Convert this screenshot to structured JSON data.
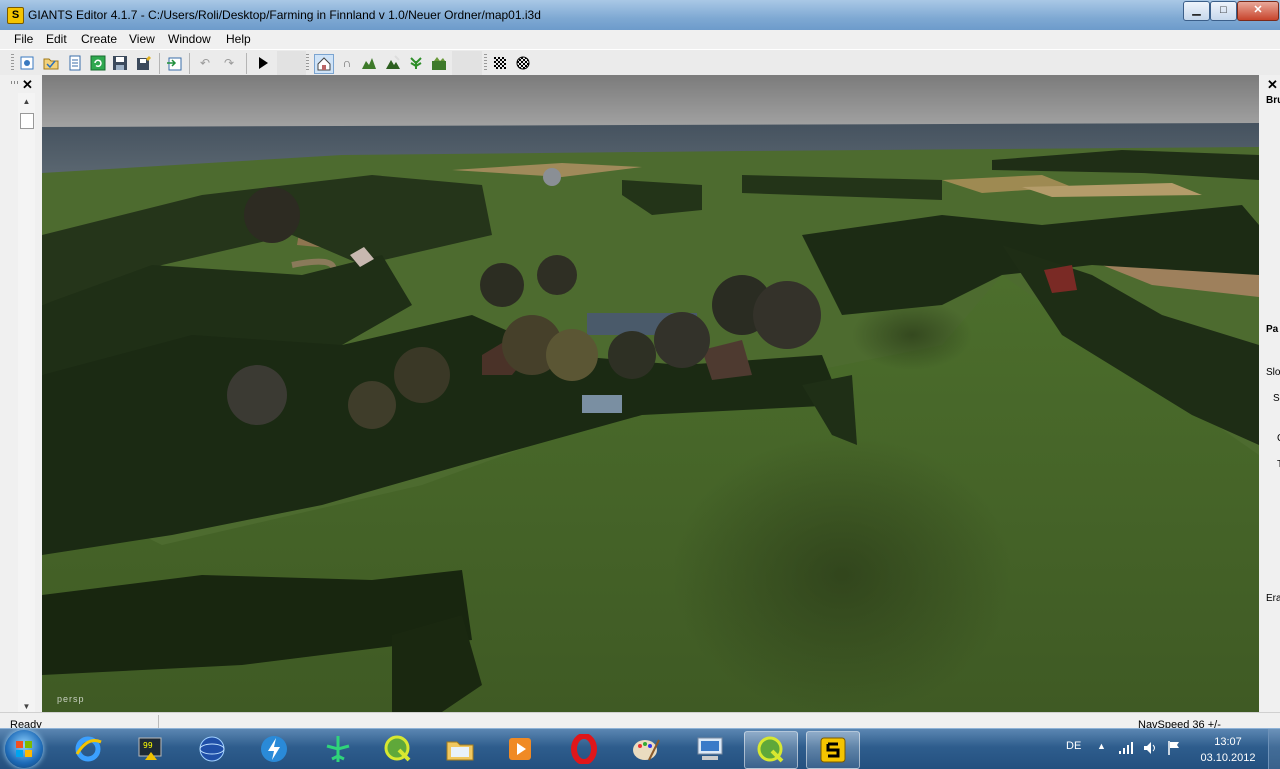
{
  "window": {
    "app_icon_letter": "S",
    "title": "GIANTS Editor 4.1.7 - C:/Users/Roli/Desktop/Farming in Finnland v 1.0/Neuer Ordner/map01.i3d",
    "min_label": "▁",
    "max_label": "□",
    "close_label": "✕"
  },
  "menu": {
    "file": "File",
    "edit": "Edit",
    "create": "Create",
    "view": "View",
    "window": "Window",
    "help": "Help"
  },
  "toolbar": {
    "icons": [
      "new-icon",
      "open-icon",
      "list-icon",
      "refresh-icon",
      "save-icon",
      "save-as-icon",
      "import-icon",
      "undo-icon",
      "redo-icon",
      "play-icon",
      "select-mode-icon",
      "move-mode-icon",
      "terrain-sculpt-icon",
      "terrain-paint-icon",
      "foliage-paint-icon",
      "terrain-detail-icon",
      "grid-icon",
      "grid-snap-icon"
    ]
  },
  "left_panel": {
    "close_label": "✕"
  },
  "viewport": {
    "camera_label": "persp"
  },
  "right_panel": {
    "close_label": "✕",
    "labels": [
      "Bru",
      "Pa",
      "Slo",
      "S",
      "C",
      "T",
      "Era"
    ]
  },
  "status": {
    "ready": "Ready",
    "navspeed": "NavSpeed 36 +/-"
  },
  "taskbar": {
    "apps": [
      "internet-explorer-icon",
      "system-monitor-icon",
      "globe-icon",
      "thunderbolt-icon",
      "plane-icon",
      "quantum-gis-icon",
      "folder-icon",
      "media-player-icon",
      "opera-icon",
      "paint-icon",
      "remote-desktop-icon",
      "quantum-gis-active-icon",
      "giants-editor-icon"
    ],
    "language": "DE",
    "time": "13:07",
    "date": "03.10.2012"
  }
}
